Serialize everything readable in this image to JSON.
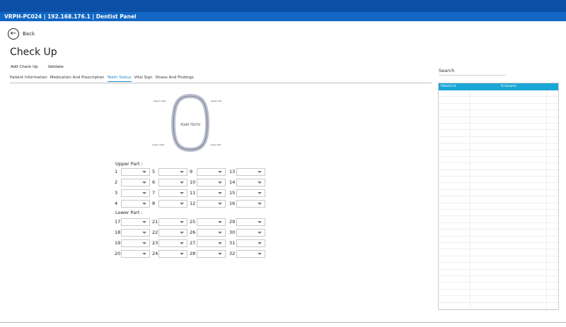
{
  "window": {
    "title": "VRPH-PC024 | 192.168.176.1 |  Dentist Panel"
  },
  "nav": {
    "back_label": "Back"
  },
  "page": {
    "title": "Check Up"
  },
  "actions": {
    "add_label": "Add Check Up",
    "validate_label": "Validate"
  },
  "tabs": [
    {
      "label": "Patient Information"
    },
    {
      "label": "Medication And Prescription"
    },
    {
      "label": "Teeth Status"
    },
    {
      "label": "Vital Sign"
    },
    {
      "label": "Illness And Findings"
    }
  ],
  "active_tab": "Teeth Status",
  "teeth_figure": {
    "center_label": "YOUR TEETH",
    "upper_right": "Upper right",
    "upper_left": "Upper left",
    "lower_right": "Lower right",
    "lower_left": "Lower left"
  },
  "upper_part": {
    "label": "Upper Part :",
    "rows": [
      [
        "1",
        "5",
        "9",
        "13"
      ],
      [
        "2",
        "6",
        "10",
        "14"
      ],
      [
        "3",
        "7",
        "11",
        "15"
      ],
      [
        "4",
        "8",
        "12",
        "16"
      ]
    ]
  },
  "lower_part": {
    "label": "Lower Part :",
    "rows": [
      [
        "17",
        "21",
        "25",
        "29"
      ],
      [
        "18",
        "22",
        "26",
        "30"
      ],
      [
        "19",
        "23",
        "27",
        "31"
      ],
      [
        "20",
        "24",
        "28",
        "32"
      ]
    ]
  },
  "search": {
    "label": "Search"
  },
  "patient_grid": {
    "columns": [
      "Patient Id",
      "Firstname"
    ]
  },
  "colors": {
    "topbar": "#0b4fa6",
    "titlebar": "#1266c4",
    "grid_header": "#1aa6d6",
    "accent": "#1e88c8"
  }
}
